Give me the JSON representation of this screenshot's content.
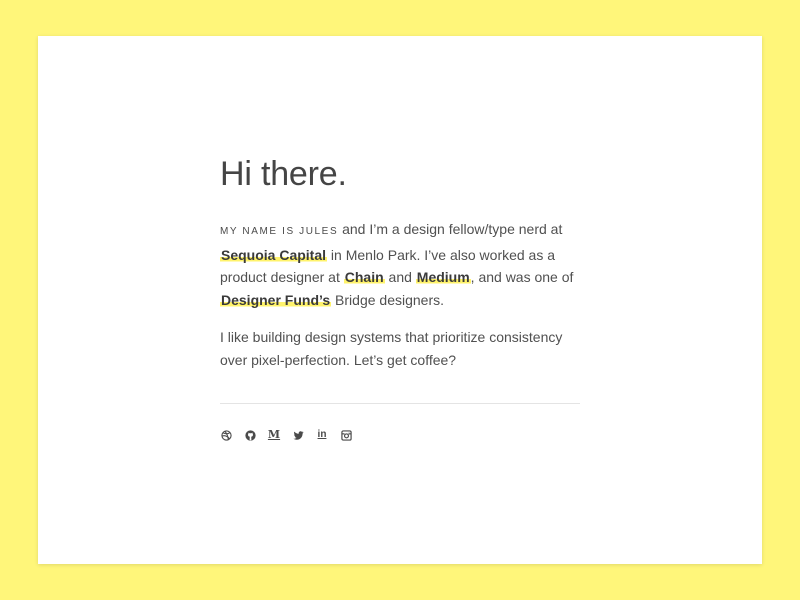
{
  "colors": {
    "background": "#fff67a",
    "card": "#ffffff",
    "text": "#4a4a4a",
    "highlight": "#fff36b"
  },
  "intro": {
    "heading": "Hi there.",
    "name_smallcaps": "my name is jules",
    "p1_after_name": " and I’m a design fellow/type nerd at ",
    "link_sequoia": "Sequoia Capital",
    "p1_after_sequoia": " in Menlo Park. I’ve also worked as a product designer at ",
    "link_chain": "Chain",
    "p1_and": " and ",
    "link_medium": "Medium",
    "p1_after_medium": ", and was one of ",
    "link_designer_fund": "Designer Fund’s",
    "p1_end": " Bridge designers.",
    "p2": "I like building design systems that prioritize consistency over pixel-perfection. Let’s get coffee?"
  },
  "social_icons": [
    "dribbble-icon",
    "github-icon",
    "medium-icon",
    "twitter-icon",
    "linkedin-icon",
    "instagram-icon"
  ],
  "social": {
    "medium_glyph": "M",
    "linkedin_glyph": "in"
  }
}
